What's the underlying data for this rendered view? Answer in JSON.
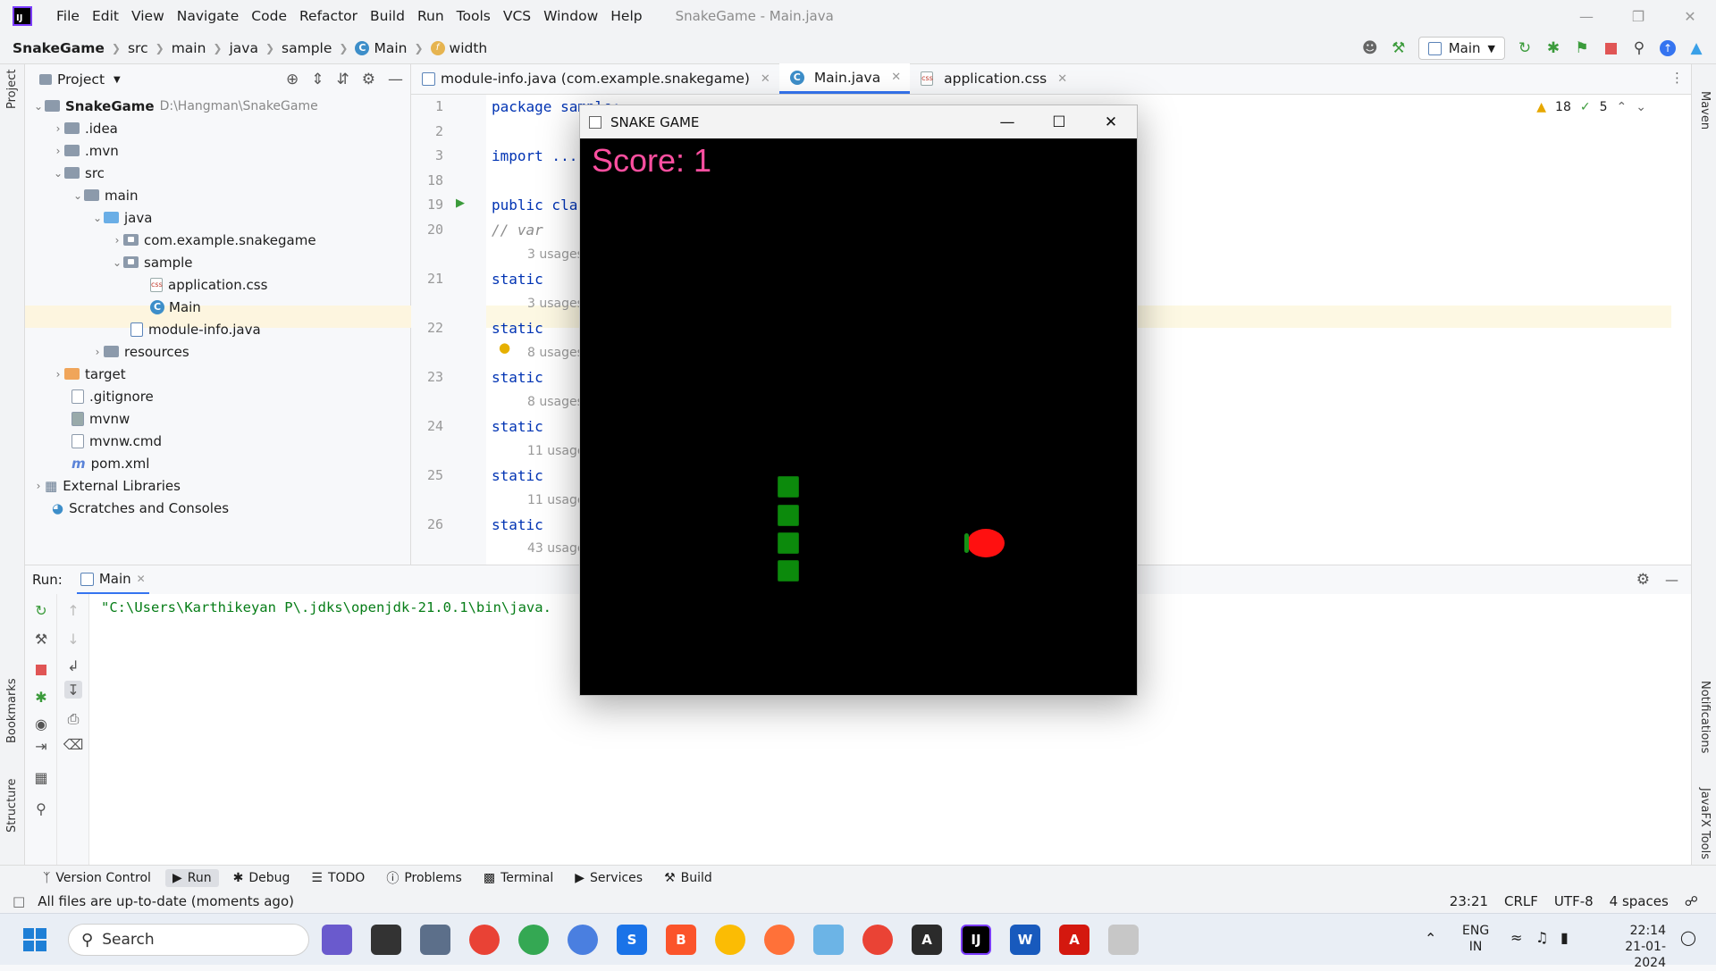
{
  "window": {
    "title": "SnakeGame - Main.java",
    "menu": [
      "File",
      "Edit",
      "View",
      "Navigate",
      "Code",
      "Refactor",
      "Build",
      "Run",
      "Tools",
      "VCS",
      "Window",
      "Help"
    ]
  },
  "breadcrumb": [
    "SnakeGame",
    "src",
    "main",
    "java",
    "sample",
    "Main",
    "width"
  ],
  "toolbar": {
    "run_config": "Main"
  },
  "project": {
    "header": "Project",
    "tree": [
      {
        "label": "SnakeGame",
        "extra": "D:\\Hangman\\SnakeGame"
      },
      {
        "label": ".idea"
      },
      {
        "label": ".mvn"
      },
      {
        "label": "src"
      },
      {
        "label": "main"
      },
      {
        "label": "java"
      },
      {
        "label": "com.example.snakegame"
      },
      {
        "label": "sample"
      },
      {
        "label": "application.css"
      },
      {
        "label": "Main"
      },
      {
        "label": "module-info.java"
      },
      {
        "label": "resources"
      },
      {
        "label": "target"
      },
      {
        "label": ".gitignore"
      },
      {
        "label": "mvnw"
      },
      {
        "label": "mvnw.cmd"
      },
      {
        "label": "pom.xml"
      },
      {
        "label": "External Libraries"
      },
      {
        "label": "Scratches and Consoles"
      }
    ]
  },
  "editor": {
    "tabs": [
      {
        "label": "module-info.java (com.example.snakegame)"
      },
      {
        "label": "Main.java"
      },
      {
        "label": "application.css"
      }
    ],
    "inspections": {
      "warnings": "18",
      "ok": "5"
    },
    "lines": [
      {
        "num": "1",
        "code": "package sample;"
      },
      {
        "num": "2",
        "code": ""
      },
      {
        "num": "3",
        "code": "import ..."
      },
      {
        "num": "18",
        "code": ""
      },
      {
        "num": "19",
        "code": "public class"
      },
      {
        "num": "20",
        "code": "    // var"
      },
      {
        "num": "21",
        "code": "    static"
      },
      {
        "num": "22",
        "code": "    static"
      },
      {
        "num": "23",
        "code": "    static"
      },
      {
        "num": "24",
        "code": "    static"
      },
      {
        "num": "25",
        "code": "    static"
      },
      {
        "num": "26",
        "code": "    static"
      }
    ],
    "usages": [
      "3 usages",
      "3 usages",
      "8 usages",
      "8 usages",
      "11 usage",
      "11 usage",
      "43 usage"
    ]
  },
  "game": {
    "title": "SNAKE GAME",
    "score": "Score: 1",
    "colors": {
      "background": "#000000",
      "snake": "#0c8a0c",
      "food": "#ff1010",
      "score": "#ff4fa0"
    }
  },
  "run": {
    "label": "Run:",
    "tab": "Main",
    "command": "\"C:\\Users\\Karthikeyan P\\.jdks\\openjdk-21.0.1\\bin\\java."
  },
  "side": {
    "left": [
      "Project",
      "Bookmarks",
      "Structure"
    ],
    "right": [
      "Maven",
      "Notifications",
      "JavaFX Tools"
    ]
  },
  "bottom_tabs": [
    "Version Control",
    "Run",
    "Debug",
    "TODO",
    "Problems",
    "Terminal",
    "Services",
    "Build"
  ],
  "status": {
    "message": "All files are up-to-date (moments ago)",
    "position": "23:21",
    "line_sep": "CRLF",
    "encoding": "UTF-8",
    "indent": "4 spaces"
  },
  "taskbar": {
    "search": "Search",
    "lang": "ENG",
    "region": "IN",
    "time": "22:14",
    "date": "21-01-2024"
  }
}
